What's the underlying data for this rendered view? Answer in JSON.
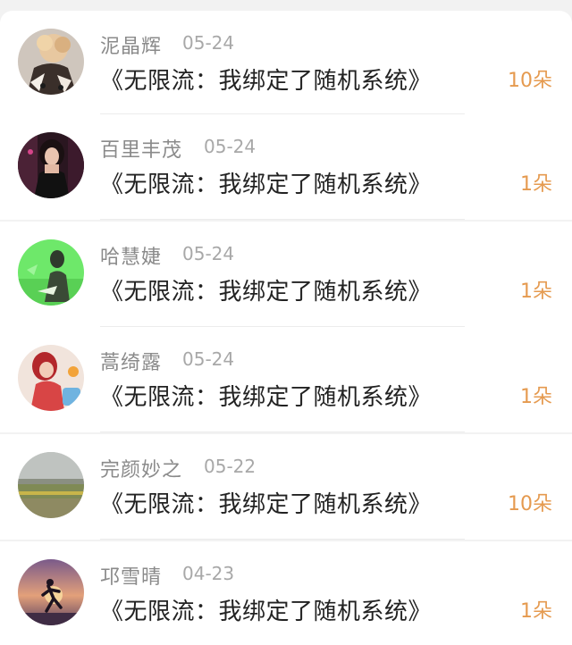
{
  "accent_color": "#e59a4f",
  "rows": [
    {
      "user": "泥晶辉",
      "date": "05-24",
      "book": "《无限流：我绑定了随机系统》",
      "gift": "10朵",
      "avatar": "avatar-woman-curly-hair"
    },
    {
      "user": "百里丰茂",
      "date": "05-24",
      "book": "《无限流：我绑定了随机系统》",
      "gift": "1朵",
      "avatar": "avatar-woman-dark-hair"
    },
    {
      "user": "哈慧婕",
      "date": "05-24",
      "book": "《无限流：我绑定了随机系统》",
      "gift": "1朵",
      "avatar": "avatar-green-photo"
    },
    {
      "user": "蒿绮露",
      "date": "05-24",
      "book": "《无限流：我绑定了随机系统》",
      "gift": "1朵",
      "avatar": "avatar-woman-red"
    },
    {
      "user": "完颜妙之",
      "date": "05-22",
      "book": "《无限流：我绑定了随机系统》",
      "gift": "10朵",
      "avatar": "avatar-landscape"
    },
    {
      "user": "邛雪晴",
      "date": "04-23",
      "book": "《无限流：我绑定了随机系统》",
      "gift": "1朵",
      "avatar": "avatar-runner-sunset"
    }
  ]
}
